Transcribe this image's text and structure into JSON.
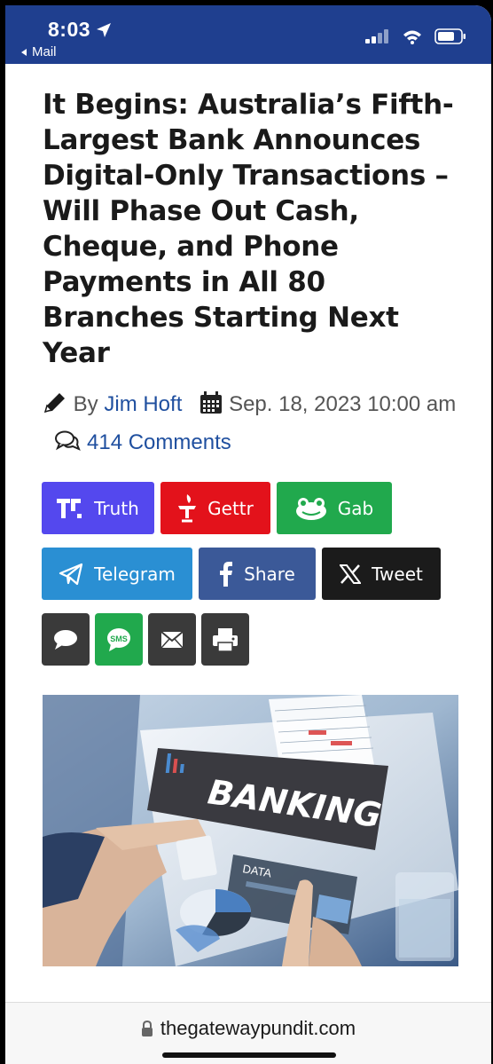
{
  "status": {
    "time": "8:03",
    "back_label": "Mail"
  },
  "article": {
    "headline": "It Begins: Australia’s Fifth-Largest Bank Announces Digital-Only Transactions – Will Phase Out Cash, Cheque, and Phone Payments in All 80 Branches Starting Next Year",
    "by": "By",
    "author": "Jim Hoft",
    "date": "Sep. 18, 2023 10:00 am",
    "comments": "414 Comments"
  },
  "share": {
    "truth": "Truth",
    "gettr": "Gettr",
    "gab": "Gab",
    "telegram": "Telegram",
    "facebook": "Share",
    "x": "Tweet",
    "sms": "SMS"
  },
  "hero": {
    "banner": "BANKING",
    "card_label": "DATA"
  },
  "browser": {
    "url": "thegatewaypundit.com"
  },
  "colors": {
    "status_bar": "#1f3f8f",
    "truth": "#5448ee",
    "gettr": "#e3121b",
    "gab": "#21a94d",
    "telegram": "#2a8fd3",
    "facebook": "#3b5998",
    "x": "#1b1b1b",
    "sms": "#21a94d",
    "link": "#1f4f9f"
  }
}
